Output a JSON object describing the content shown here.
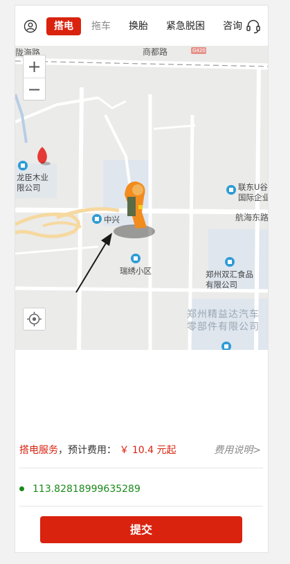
{
  "nav": {
    "tabs": [
      {
        "label": "搭电",
        "active": true
      },
      {
        "label": "拖车",
        "active": false
      },
      {
        "label": "换胎",
        "active": false
      },
      {
        "label": "紧急脱困",
        "active": false
      },
      {
        "label": "咨询",
        "active": false
      }
    ]
  },
  "map": {
    "zoom_in": "+",
    "zoom_out": "−",
    "roads": {
      "top_left": "陇海路",
      "top_center": "商都路",
      "right": "航海东路",
      "badge": "G420"
    },
    "pois": [
      {
        "name": "龙臣木业有限公司",
        "lines": [
          "龙臣木业",
          "限公司"
        ]
      },
      {
        "name": "中兴",
        "lines": [
          "中兴"
        ]
      },
      {
        "name": "瑞绣小区",
        "lines": [
          "瑞绣小区"
        ]
      },
      {
        "name": "联东U谷国际企业",
        "lines": [
          "联东U谷",
          "国际企业"
        ]
      },
      {
        "name": "郑州双汇食品有限公司",
        "lines": [
          "郑州双汇食品",
          "有限公司"
        ]
      },
      {
        "name": "郑州精益达汽车零部件有限公司",
        "lines": [
          "郑州精益达汽车",
          "零部件有限公司"
        ]
      }
    ]
  },
  "service": {
    "name": "搭电服务",
    "separator": "，",
    "estimate_label": "预计费用：",
    "price": "￥ 10.4 元起",
    "help": "费用说明>"
  },
  "location": {
    "coordinate": "113.82818999635289"
  },
  "submit_label": "提交",
  "colors": {
    "accent": "#d9230f",
    "coord": "#1a8a1a",
    "muted": "#8a8a8a"
  }
}
